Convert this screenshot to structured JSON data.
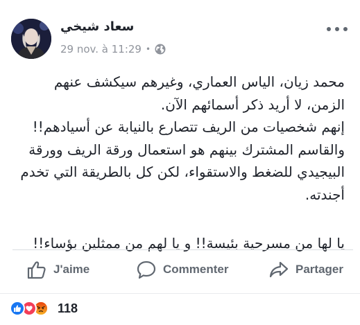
{
  "post": {
    "author": "سعاد شيخي",
    "timestamp": "29 nov. à 11:29",
    "privacy_icon": "globe-icon",
    "more_icon": "more-horizontal-icon",
    "paragraphs": [
      "محمد زيان، الياس العماري، وغيرهم سيكشف عنهم الزمن، لا أريد ذكر أسمائهم الآن.",
      "إنهم شخصيات من الريف تتصارع بالنيابة عن أسيادهم!!",
      "والقاسم المشترك بينهم هو استعمال ورقة الريف وورقة البيجيدي للضغط والاستقواء، لكن كل بالطريقة التي تخدم أجندته.",
      "يا لها من مسرحية بئيسة!! و يا لهم من ممثلين بؤساء!!"
    ]
  },
  "actions": {
    "like_label": "J'aime",
    "comment_label": "Commenter",
    "share_label": "Partager"
  },
  "reactions": {
    "icons": [
      "like",
      "love",
      "angry"
    ],
    "count": "118"
  },
  "colors": {
    "text": "#1d2129",
    "secondary": "#606770",
    "meta": "#90949c",
    "like_blue": "#1877f2",
    "love_red": "#f33e58",
    "angry_yellow": "#f7b125"
  }
}
